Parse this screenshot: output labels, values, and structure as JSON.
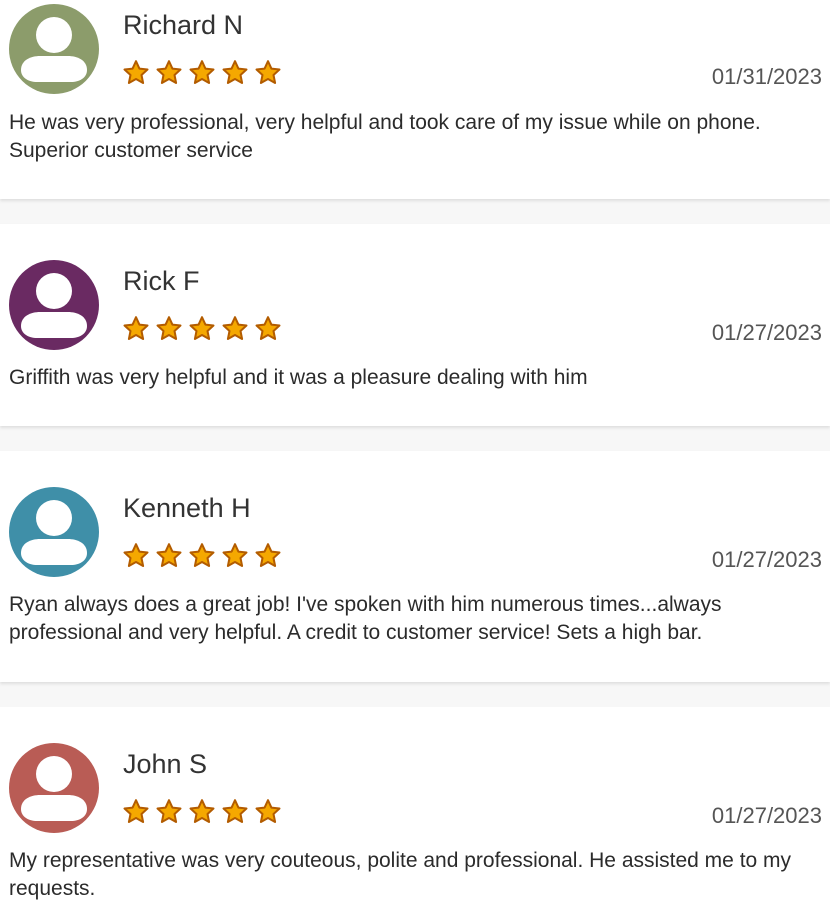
{
  "reviews": [
    {
      "name": "Richard N",
      "date": "01/31/2023",
      "rating": 5,
      "text": "He was very professional, very helpful and took care of my issue while on phone. Superior customer service",
      "avatar_color": "#8c9c6b",
      "avatar_icon": "user-icon"
    },
    {
      "name": "Rick F",
      "date": "01/27/2023",
      "rating": 5,
      "text": "Griffith was very helpful and it was a pleasure dealing with him",
      "avatar_color": "#6a2a62",
      "avatar_icon": "user-icon"
    },
    {
      "name": "Kenneth H",
      "date": "01/27/2023",
      "rating": 5,
      "text": "Ryan always does a great job! I've spoken with him numerous times...always professional and very helpful. A credit to customer service! Sets a high bar.",
      "avatar_color": "#3f8fa8",
      "avatar_icon": "user-icon"
    },
    {
      "name": "John S",
      "date": "01/27/2023",
      "rating": 5,
      "text": "My representative was very couteous, polite and professional. He assisted me to my requests.",
      "avatar_color": "#b95c55",
      "avatar_icon": "user-icon"
    }
  ],
  "colors": {
    "star_fill": "#f5a800",
    "star_stroke": "#b35c00",
    "card_background": "#ffffff",
    "page_background": "#f7f7f7"
  }
}
